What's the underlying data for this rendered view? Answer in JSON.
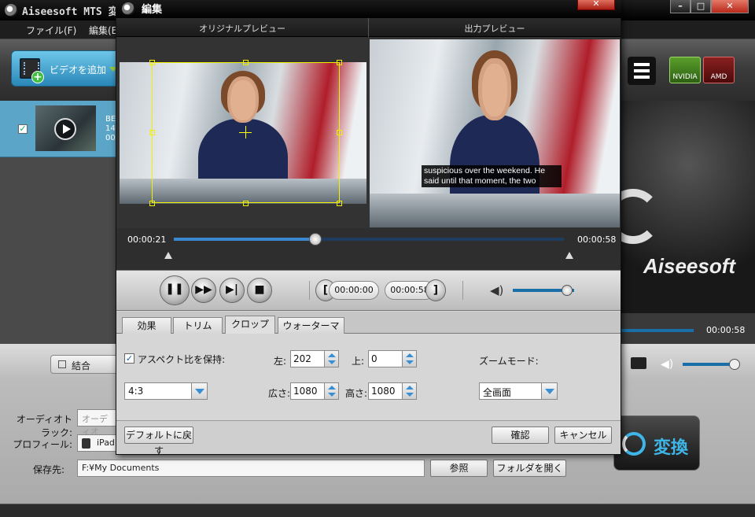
{
  "main": {
    "title": "Aiseesoft MTS 変",
    "window_buttons": [
      "–",
      "□",
      "✕"
    ],
    "menu": [
      "ファイル(F)",
      "編集(E"
    ],
    "add_video_label": "ビデオを追加",
    "file": {
      "name": "BE",
      "size": "14",
      "duration": "00:"
    },
    "gpu": [
      "NVIDIA",
      "AMD"
    ],
    "brand": "Aiseesoft",
    "right_time": "00:00:58",
    "combine_label": "結合",
    "audio_track_label": "オーディオトラック:",
    "audio_track_value": "オーディオ",
    "profile_label": "プロフィール:",
    "profile_value": "iPad",
    "save_label": "保存先:",
    "save_path": "F:¥My Documents",
    "browse_label": "参照",
    "open_folder_label": "フォルダを開く",
    "convert_label": "変換"
  },
  "dialog": {
    "title": "編集",
    "close": "✕",
    "original_preview": "オリジナルプレビュー",
    "output_preview": "出力プレビュー",
    "subtitle": "suspicious over the weekend. He said until that moment, the two",
    "time_current": "00:00:21",
    "time_total": "00:00:58",
    "progress_fraction": 0.362,
    "start_time": "00:00:00",
    "end_time": "00:00:58",
    "volume_fraction": 0.88,
    "tabs": [
      "効果",
      "トリム",
      "クロップ",
      "ウォーターマーク"
    ],
    "active_tab": "クロップ",
    "keep_aspect_label": "アスペクト比を保持:",
    "keep_aspect_checked": true,
    "aspect_value": "4:3",
    "left_label": "左:",
    "left_value": "202",
    "top_label": "上:",
    "top_value": "0",
    "width_label": "広さ:",
    "width_value": "1080",
    "height_label": "高さ:",
    "height_value": "1080",
    "zoom_mode_label": "ズームモード:",
    "zoom_mode_value": "全画面",
    "reset_label": "デフォルトに戻す",
    "ok_label": "確認",
    "cancel_label": "キャンセル"
  },
  "colors": {
    "accent_blue": "#3b8ad1",
    "crop_yellow": "#f0f000",
    "toolbar_cyan": "#5ba6c8"
  }
}
